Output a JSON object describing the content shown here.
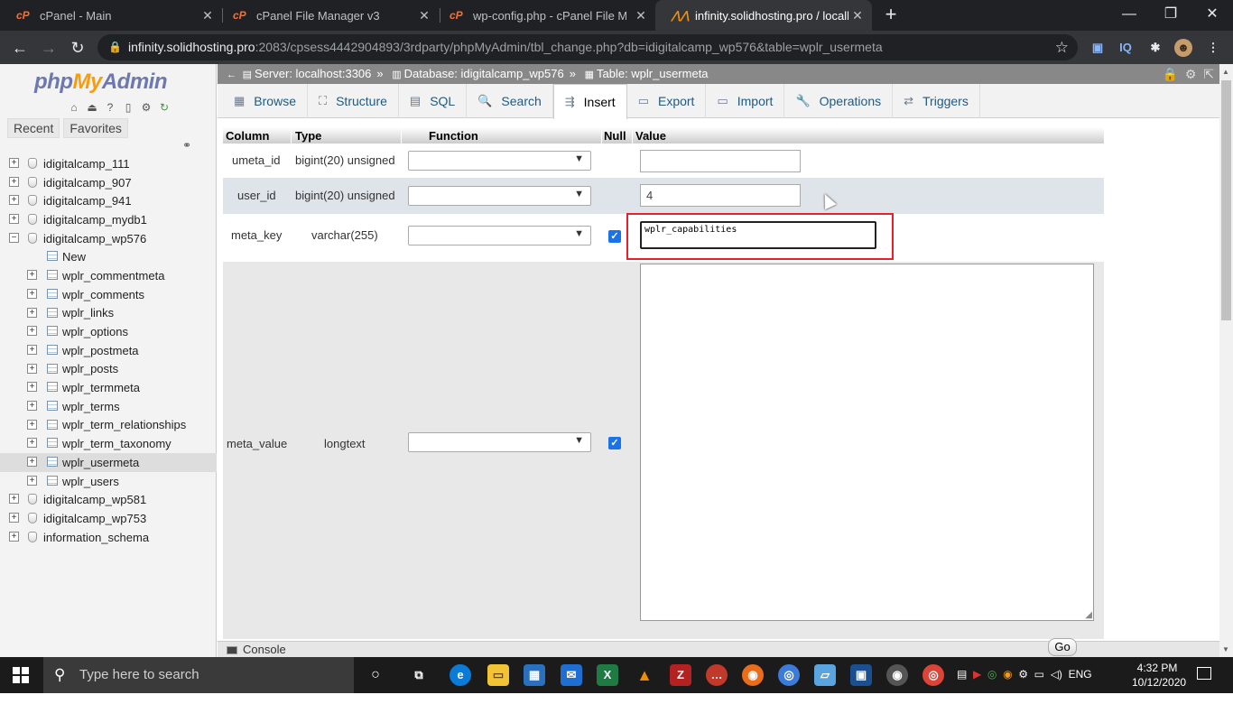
{
  "browser": {
    "tabs": [
      {
        "label": "cPanel - Main",
        "favicon": "cpanel-icon"
      },
      {
        "label": "cPanel File Manager v3",
        "favicon": "cpanel-icon"
      },
      {
        "label": "wp-config.php - cPanel File Mana",
        "favicon": "cpanel-icon"
      },
      {
        "label": "infinity.solidhosting.pro / localho",
        "favicon": "phpmyadmin-icon"
      }
    ],
    "url_host": "infinity.solidhosting.pro",
    "url_path": ":2083/cpsess4442904893/3rdparty/phpMyAdmin/tbl_change.php?db=idigitalcamp_wp576&table=wplr_usermeta"
  },
  "sidebar": {
    "logo_php": "php",
    "logo_my": "My",
    "logo_admin": "Admin",
    "recent_label": "Recent",
    "favorites_label": "Favorites",
    "databases": [
      {
        "name": "idigitalcamp_111",
        "expanded": false
      },
      {
        "name": "idigitalcamp_907",
        "expanded": false
      },
      {
        "name": "idigitalcamp_941",
        "expanded": false
      },
      {
        "name": "idigitalcamp_mydb1",
        "expanded": false
      },
      {
        "name": "idigitalcamp_wp576",
        "expanded": true
      }
    ],
    "new_label": "New",
    "tables": [
      "wplr_commentmeta",
      "wplr_comments",
      "wplr_links",
      "wplr_options",
      "wplr_postmeta",
      "wplr_posts",
      "wplr_termmeta",
      "wplr_terms",
      "wplr_term_relationships",
      "wplr_term_taxonomy",
      "wplr_usermeta",
      "wplr_users"
    ],
    "selected_table": "wplr_usermeta",
    "more_databases": [
      "idigitalcamp_wp581",
      "idigitalcamp_wp753",
      "information_schema"
    ]
  },
  "breadcrumb": {
    "server": "Server: localhost:3306",
    "database": "Database: idigitalcamp_wp576",
    "table": "Table: wplr_usermeta",
    "sep": "»"
  },
  "tabs": [
    "Browse",
    "Structure",
    "SQL",
    "Search",
    "Insert",
    "Export",
    "Import",
    "Operations",
    "Triggers"
  ],
  "active_tab": "Insert",
  "form": {
    "headers": {
      "column": "Column",
      "type": "Type",
      "function": "Function",
      "null": "Null",
      "value": "Value"
    },
    "rows": [
      {
        "column": "umeta_id",
        "type": "bigint(20) unsigned",
        "value": "",
        "null_checked": false
      },
      {
        "column": "user_id",
        "type": "bigint(20) unsigned",
        "value": "4",
        "null_checked": false
      },
      {
        "column": "meta_key",
        "type": "varchar(255)",
        "value": "wplr_capabilities",
        "null_checked": true
      },
      {
        "column": "meta_value",
        "type": "longtext",
        "value": "",
        "null_checked": true
      }
    ],
    "go_label": "Go"
  },
  "console_label": "Console",
  "taskbar": {
    "search_placeholder": "Type here to search",
    "time": "4:32 PM",
    "date": "10/12/2020"
  },
  "colors": {
    "highlight": "#e8202a",
    "link": "#235a81"
  }
}
